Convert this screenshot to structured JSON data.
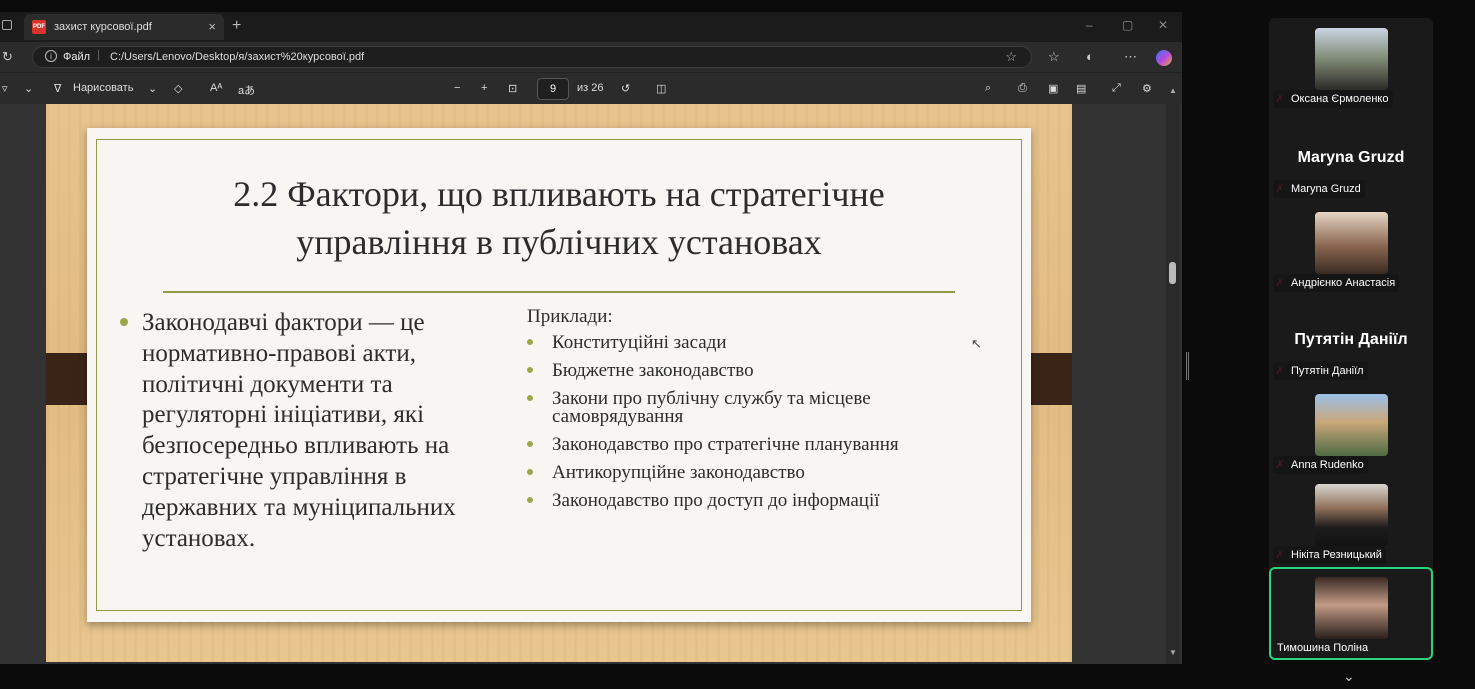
{
  "browser": {
    "tab_title": "захист курсової.pdf",
    "tab_close": "×",
    "new_tab": "+",
    "address_scheme": "Файл",
    "address_separator": "|",
    "address_url": "C:/Users/Lenovo/Desktop/я/захист%20курсової.pdf",
    "window_controls": [
      "–",
      "▢",
      "✕"
    ]
  },
  "pdf_toolbar": {
    "draw_label": "Нарисовать",
    "read_aloud": "Aᴬ",
    "translate": "аあ",
    "zoom_out": "−",
    "zoom_in": "+",
    "current_page": "9",
    "page_total": "из 26"
  },
  "slide": {
    "title_line1": "2.2 Фактори, що впливають на стратегічне",
    "title_line2": "управління в публічних установах",
    "left_text": "Законодавчі фактори — це нормативно-правові акти, політичні документи та регуляторні ініціативи, які безпосередньо впливають на стратегічне управління в державних та муніципальних установах.",
    "examples_heading": "Приклади:",
    "examples": [
      "Конституційні засади",
      "Бюджетне законодавство",
      "Закони про публічну службу та місцеве самоврядування",
      "Законодавство про стратегічне планування",
      "Антикорупційне законодавство",
      "Законодавство про доступ до інформації"
    ]
  },
  "participants": [
    {
      "name": "Оксана Єрмоленко",
      "has_video": true,
      "muted": true
    },
    {
      "name": "Maryna Gruzd",
      "display_name": "Maryna Gruzd",
      "has_video": false,
      "muted": true
    },
    {
      "name": "Андрієнко Анастасія",
      "has_video": true,
      "muted": true
    },
    {
      "name": "Путятін Даніїл",
      "display_name": "Путятін Даніїл",
      "has_video": false,
      "muted": true
    },
    {
      "name": "Anna Rudenko",
      "has_video": true,
      "muted": true
    },
    {
      "name": "Нікіта Резницький",
      "has_video": true,
      "muted": true
    },
    {
      "name": "Тимошина Поліна",
      "has_video": true,
      "muted": false,
      "active_speaker": true
    }
  ],
  "colors": {
    "slide_accent": "#8d9a47",
    "active_speaker": "#28d47e",
    "mic_muted": "#e23d3d"
  }
}
